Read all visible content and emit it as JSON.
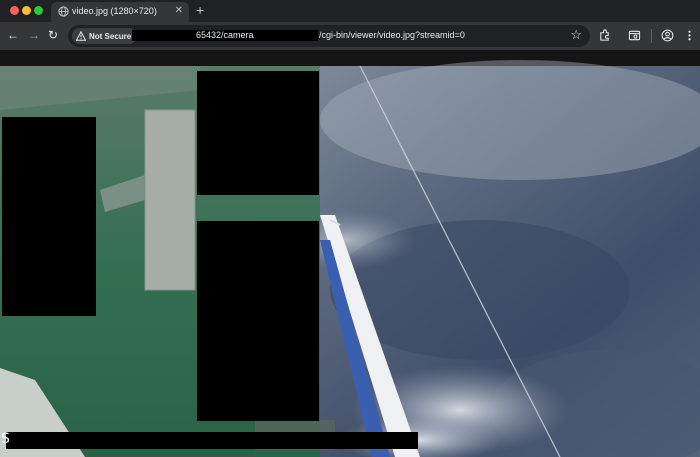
{
  "browser": {
    "tab": {
      "title": "video.jpg (1280×720)",
      "favicon": "globe-icon"
    },
    "new_tab_label": "+",
    "security_label": "Not Secure",
    "url": {
      "part1": "65432/camera/",
      "part2": "/cgi-bin/viewer/video.jpg?streamid=0"
    }
  },
  "overlay": {
    "caption": "S"
  },
  "colors": {
    "deck": "#2f6b4e",
    "sea": "#4e5e78",
    "rail": "#3a5fb0",
    "chrome_bg": "#202124",
    "toolbar_bg": "#35363a"
  }
}
